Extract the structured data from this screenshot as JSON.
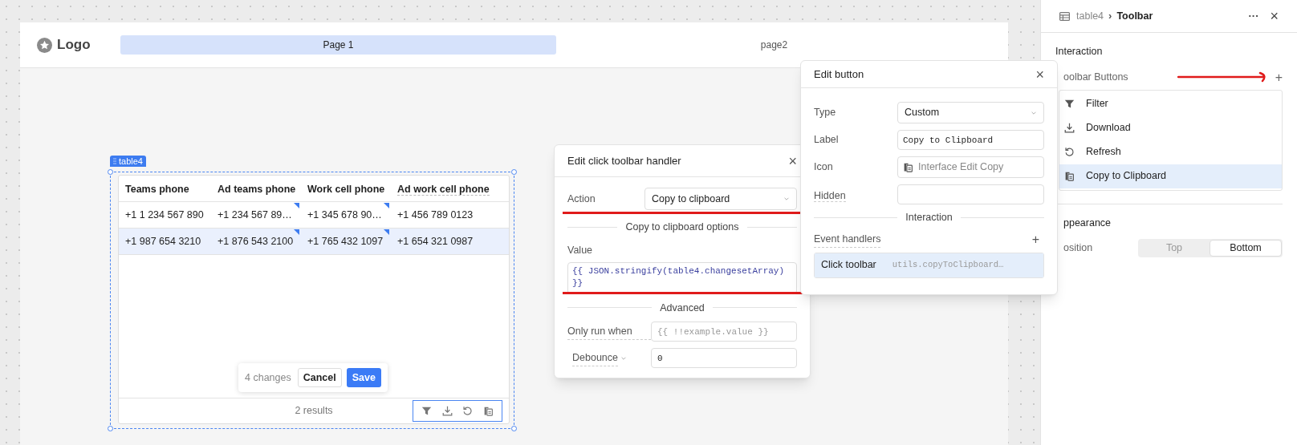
{
  "app_header": {
    "logo": "Logo",
    "nav": [
      {
        "label": "Page 1",
        "selected": true
      },
      {
        "label": "page2",
        "selected": false
      }
    ]
  },
  "table": {
    "badge": "table4",
    "columns": [
      "Teams phone",
      "Ad teams phone",
      "Work cell phone",
      "Ad work cell phone"
    ],
    "rows": [
      {
        "selected": false,
        "cells": [
          {
            "text": "+1 1 234 567 890",
            "changed": false
          },
          {
            "text": "+1 234 567 89…",
            "changed": true
          },
          {
            "text": "+1 345 678 90…",
            "changed": true
          },
          {
            "text": "+1 456 789 0123",
            "changed": false
          }
        ]
      },
      {
        "selected": true,
        "cells": [
          {
            "text": "+1 987 654 3210",
            "changed": false
          },
          {
            "text": "+1 876 543 2100",
            "changed": true
          },
          {
            "text": "+1 765 432 1097",
            "changed": true
          },
          {
            "text": "+1 654 321 0987",
            "changed": false
          }
        ]
      }
    ],
    "changes": {
      "count": "4 changes",
      "cancel": "Cancel",
      "save": "Save"
    },
    "footer": "2 results",
    "toolbar": [
      {
        "kind": "filter"
      },
      {
        "kind": "download"
      },
      {
        "kind": "refresh"
      },
      {
        "kind": "copy"
      }
    ]
  },
  "handler_dialog": {
    "title": "Edit click toolbar handler",
    "close": "×",
    "action_label": "Action",
    "action_value": "Copy to clipboard",
    "options_heading": "Copy to clipboard options",
    "value_label": "Value",
    "value_code": "{{ JSON.stringify(table4.changesetArray) }}",
    "advanced_heading": "Advanced",
    "only_run_label": "Only run when",
    "only_run_placeholder": "{{ !!example.value }}",
    "debounce_label": "Debounce",
    "debounce_value": "0"
  },
  "button_dialog": {
    "title": "Edit button",
    "close": "×",
    "type_label": "Type",
    "type_value": "Custom",
    "label_label": "Label",
    "label_value": "Copy to Clipboard",
    "icon_label": "Icon",
    "icon_value": "Interface Edit Copy",
    "hidden_label": "Hidden",
    "interaction_heading": "Interaction",
    "event_handlers_label": "Event handlers",
    "add": "+",
    "handlers": [
      {
        "event": "Click toolbar",
        "code": "utils.copyToClipboard…",
        "selected": true
      }
    ]
  },
  "inspector": {
    "breadcrumb_parent": "table4",
    "breadcrumb_sep": "›",
    "breadcrumb_current": "Toolbar",
    "more": "···",
    "close": "×",
    "interaction_heading": "Interaction",
    "toolbar_buttons_label": "oolbar Buttons",
    "add": "+",
    "buttons": [
      {
        "kind": "filter",
        "label": "Filter",
        "selected": false
      },
      {
        "kind": "download",
        "label": "Download",
        "selected": false
      },
      {
        "kind": "refresh",
        "label": "Refresh",
        "selected": false
      },
      {
        "kind": "copy",
        "label": "Copy to Clipboard",
        "selected": true
      }
    ],
    "appearance_heading": "ppearance",
    "position_label": "osition",
    "position_options": [
      {
        "label": "Top",
        "selected": false
      },
      {
        "label": "Bottom",
        "selected": true
      }
    ]
  }
}
